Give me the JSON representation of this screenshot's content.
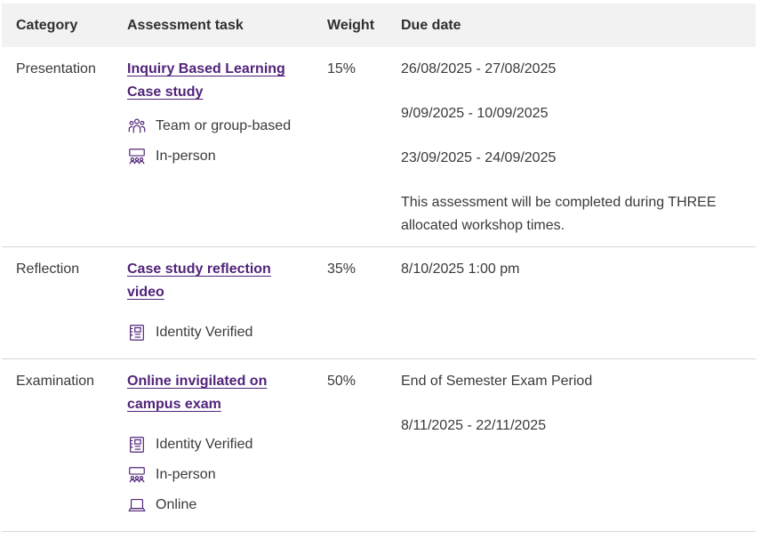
{
  "headers": {
    "category": "Category",
    "task": "Assessment task",
    "weight": "Weight",
    "due": "Due date"
  },
  "rows": [
    {
      "category": "Presentation",
      "task_line1": "Inquiry Based Learning",
      "task_line2": "Case study",
      "attributes": [
        {
          "icon": "team-icon",
          "label": "Team or group-based"
        },
        {
          "icon": "in-person-icon",
          "label": "In-person"
        }
      ],
      "weight": "15%",
      "due": [
        "26/08/2025 - 27/08/2025",
        "9/09/2025 - 10/09/2025",
        "23/09/2025 - 24/09/2025",
        "This assessment will be completed during THREE allocated workshop times."
      ]
    },
    {
      "category": "Reflection",
      "task_line1": "Case study reflection",
      "task_line2": "video",
      "attributes": [
        {
          "icon": "identity-verified-icon",
          "label": "Identity Verified"
        }
      ],
      "weight": "35%",
      "due": [
        "8/10/2025 1:00 pm"
      ]
    },
    {
      "category": "Examination",
      "task_line1": "Online invigilated on",
      "task_line2": "campus exam",
      "attributes": [
        {
          "icon": "identity-verified-icon",
          "label": "Identity Verified"
        },
        {
          "icon": "in-person-icon",
          "label": "In-person"
        },
        {
          "icon": "laptop-icon",
          "label": "Online"
        }
      ],
      "weight": "50%",
      "due": [
        "End of Semester Exam Period",
        "8/11/2025 - 22/11/2025"
      ]
    }
  ],
  "colors": {
    "link": "#51247a",
    "icon": "#51247a",
    "header_bg": "#f2f2f2"
  }
}
